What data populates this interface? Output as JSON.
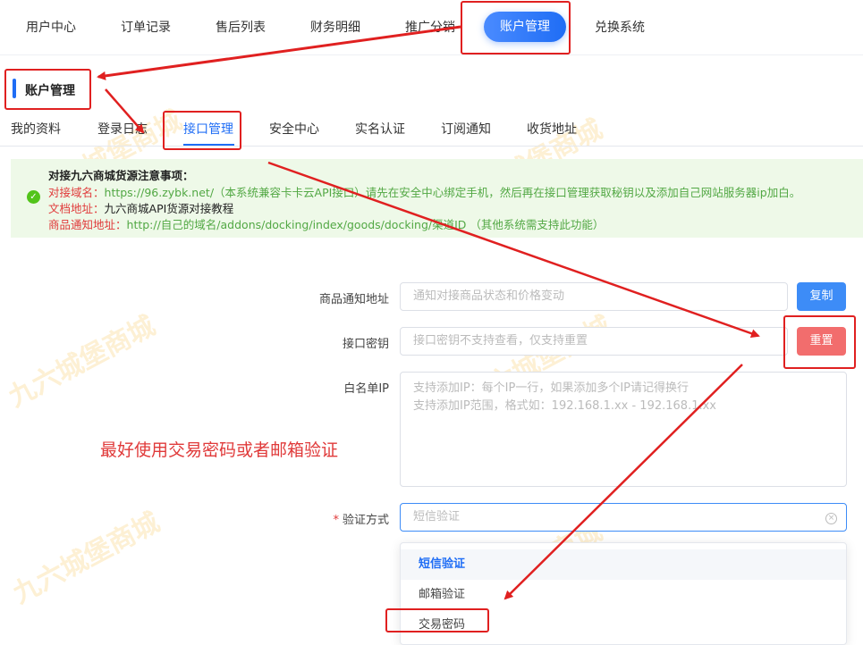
{
  "topnav": {
    "items": [
      {
        "label": "用户中心"
      },
      {
        "label": "订单记录"
      },
      {
        "label": "售后列表"
      },
      {
        "label": "财务明细"
      },
      {
        "label": "推广分销"
      },
      {
        "label": "账户管理",
        "active": true
      },
      {
        "label": "兑换系统"
      }
    ]
  },
  "section": {
    "title": "账户管理"
  },
  "subtabs": {
    "items": [
      {
        "label": "我的资料"
      },
      {
        "label": "登录日志"
      },
      {
        "label": "接口管理",
        "active": true
      },
      {
        "label": "安全中心"
      },
      {
        "label": "实名认证"
      },
      {
        "label": "订阅通知"
      },
      {
        "label": "收货地址"
      }
    ]
  },
  "notice": {
    "title": "对接九六商城货源注意事项：",
    "domain_label": "对接域名：",
    "domain_text": "https://96.zybk.net/（本系统兼容卡卡云API接口）请先在安全中心绑定手机，然后再在接口管理获取秘钥以及添加自己网站服务器ip加白。",
    "doc_label": "文档地址：",
    "doc_text": "九六商城API货源对接教程",
    "notify_label": "商品通知地址：",
    "notify_text": "http://自己的域名/addons/docking/index/goods/docking/渠道ID （其他系统需支持此功能）"
  },
  "form": {
    "notify_url": {
      "label": "商品通知地址",
      "placeholder": "通知对接商品状态和价格变动",
      "button": "复制"
    },
    "api_key": {
      "label": "接口密钥",
      "placeholder": "接口密钥不支持查看，仅支持重置",
      "button": "重置"
    },
    "whitelist": {
      "label": "白名单IP",
      "placeholder_line1": "支持添加IP：每个IP一行，如果添加多个IP请记得换行",
      "placeholder_line2": "支持添加IP范围，格式如：192.168.1.xx - 192.168.1.xx"
    },
    "verify": {
      "required_mark": "*",
      "label": "验证方式",
      "placeholder": "短信验证",
      "options": [
        "短信验证",
        "邮箱验证",
        "交易密码"
      ],
      "selected": "短信验证"
    }
  },
  "annotation": {
    "hint": "最好使用交易密码或者邮箱验证",
    "color": "#e02020"
  },
  "watermark": "九六城堡商城",
  "colors": {
    "primary": "#1f6df5",
    "danger": "#f26d6d",
    "success": "#52c41a",
    "notice_bg": "#eef9e8"
  }
}
